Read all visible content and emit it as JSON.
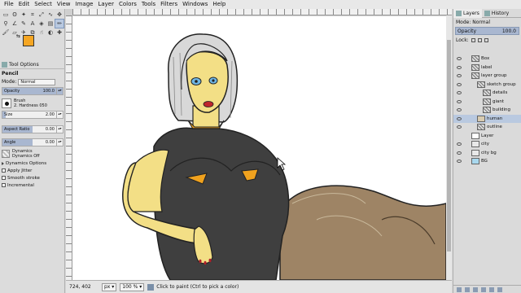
{
  "menu": [
    "File",
    "Edit",
    "Select",
    "View",
    "Image",
    "Layer",
    "Colors",
    "Tools",
    "Filters",
    "Windows",
    "Help"
  ],
  "colors": {
    "foreground": "#f5a623",
    "background": "#ffffff"
  },
  "tool_options": {
    "tab": "Tool Options",
    "title": "Pencil",
    "mode_label": "Mode:",
    "mode_value": "Normal",
    "opacity_label": "Opacity",
    "opacity_value": "100.0",
    "opacity_fraction": 1.0,
    "brush_label": "Brush",
    "brush_value": "2. Hardness 050",
    "size_label": "Size",
    "size_value": "2.00",
    "aspect_label": "Aspect Ratio",
    "aspect_value": "0.00",
    "angle_label": "Angle",
    "angle_value": "0.00",
    "dynamics_label": "Dynamics",
    "dynamics_value": "Dynamics Off",
    "dynamics_options": "Dynamics Options",
    "apply_jitter": "Apply Jitter",
    "smooth_stroke": "Smooth stroke",
    "incremental": "Incremental"
  },
  "status": {
    "coords": "724, 402",
    "unit": "px",
    "zoom": "100 %",
    "message": "Click to paint (Ctrl to pick a color)"
  },
  "dock": {
    "tabs": [
      "Layers",
      "History"
    ],
    "mode_label": "Mode: Normal",
    "opacity_label": "Opacity",
    "opacity_value": "100.0",
    "lock_label": "Lock:",
    "layers": [
      {
        "name": "Box",
        "thumb": "group",
        "indent": 0,
        "eye": true
      },
      {
        "name": "label",
        "thumb": "group",
        "indent": 0,
        "eye": true
      },
      {
        "name": "layer group",
        "thumb": "group",
        "indent": 0,
        "eye": true
      },
      {
        "name": "sketch group",
        "thumb": "group",
        "indent": 1,
        "eye": true
      },
      {
        "name": "details",
        "thumb": "group",
        "indent": 2,
        "eye": true
      },
      {
        "name": "giant",
        "thumb": "group",
        "indent": 2,
        "eye": true
      },
      {
        "name": "building",
        "thumb": "group",
        "indent": 2,
        "eye": true
      },
      {
        "name": "human",
        "thumb": "human",
        "indent": 1,
        "eye": true,
        "selected": true
      },
      {
        "name": "outline",
        "thumb": "group",
        "indent": 1,
        "eye": true
      },
      {
        "name": "Layer",
        "thumb": "white",
        "indent": 0,
        "eye": false
      },
      {
        "name": "city",
        "thumb": "city",
        "indent": 0,
        "eye": true
      },
      {
        "name": "city bg",
        "thumb": "city",
        "indent": 0,
        "eye": true
      },
      {
        "name": "BG",
        "thumb": "blue",
        "indent": 0,
        "eye": true
      }
    ]
  }
}
